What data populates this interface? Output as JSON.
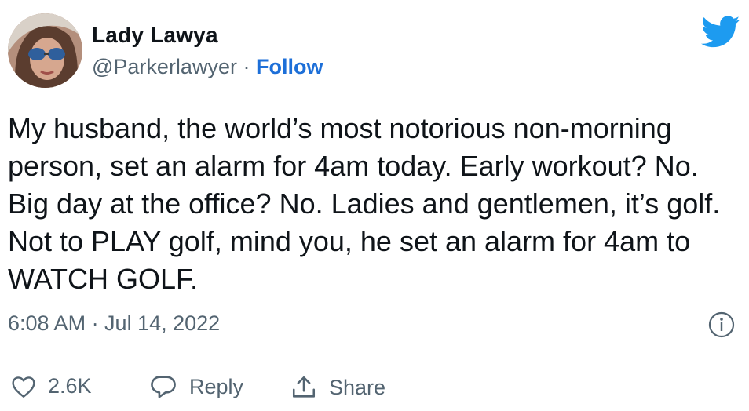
{
  "author": {
    "display_name": "Lady Lawya",
    "handle": "@Parkerlawyer",
    "separator": "·",
    "follow_label": "Follow"
  },
  "tweet": {
    "text": "My husband, the world’s most notorious non-morning person, set an alarm for 4am today. Early workout? No. Big day at the office?  No. Ladies and gentlemen, it’s golf. Not to PLAY golf, mind you, he set an alarm for 4am to WATCH GOLF.",
    "timestamp": "6:08 AM · Jul 14, 2022"
  },
  "actions": {
    "like_count": "2.6K",
    "reply_label": "Reply",
    "share_label": "Share"
  },
  "icons": [
    "avatar-photo",
    "twitter-bird-icon",
    "info-icon",
    "heart-icon",
    "reply-bubble-icon",
    "share-icon"
  ],
  "colors": {
    "brand_blue": "#1d9bf0",
    "follow_link": "#1d6fd8",
    "text_primary": "#0f1419",
    "text_secondary": "#536471",
    "divider": "#cfd9de"
  }
}
